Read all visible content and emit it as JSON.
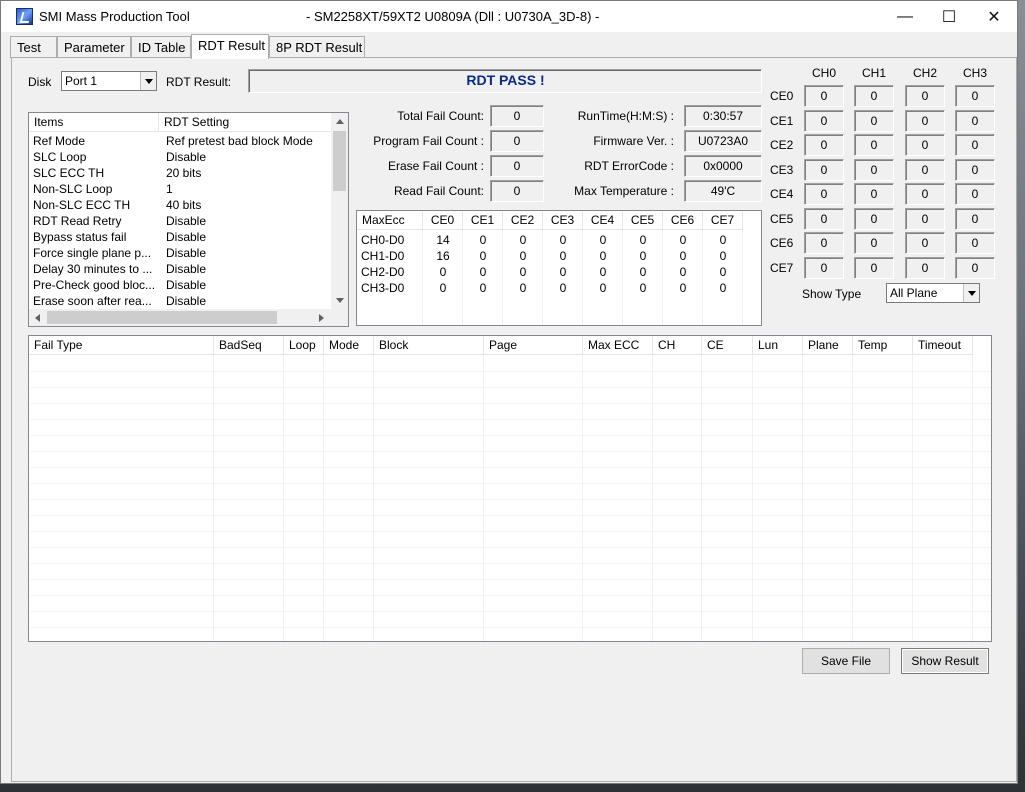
{
  "window": {
    "title": "SMI Mass Production Tool",
    "subtitle": "- SM2258XT/59XT2    U0809A      (Dll : U0730A_3D-8) -",
    "minimize_glyph": "—",
    "maximize_glyph": "☐",
    "close_glyph": "✕"
  },
  "tabs": [
    "Test",
    "Parameter",
    "ID Table",
    "RDT Result",
    "8P RDT Result"
  ],
  "active_tab": "RDT Result",
  "disk": {
    "label": "Disk",
    "value": "Port 1"
  },
  "rdt_result": {
    "label": "RDT Result:",
    "value": "RDT PASS !",
    "color": "#0a2a8a"
  },
  "settings": {
    "headers": [
      "Items",
      "RDT Setting"
    ],
    "rows": [
      [
        "Ref Mode",
        "Ref pretest bad block Mode"
      ],
      [
        "SLC Loop",
        "Disable"
      ],
      [
        "SLC ECC TH",
        "20 bits"
      ],
      [
        "Non-SLC Loop",
        "1"
      ],
      [
        "Non-SLC ECC TH",
        "40 bits"
      ],
      [
        "RDT Read Retry",
        "Disable"
      ],
      [
        "Bypass status fail",
        "Disable"
      ],
      [
        "Force single plane p...",
        "Disable"
      ],
      [
        "Delay 30 minutes to ...",
        "Disable"
      ],
      [
        "Pre-Check good bloc...",
        "Disable"
      ],
      [
        "Erase soon after rea...",
        "Disable"
      ]
    ]
  },
  "stats_left": [
    {
      "label": "Total Fail Count:",
      "value": "0"
    },
    {
      "label": "Program Fail Count :",
      "value": "0"
    },
    {
      "label": "Erase Fail Count :",
      "value": "0"
    },
    {
      "label": "Read Fail Count:",
      "value": "0"
    }
  ],
  "stats_right": [
    {
      "label": "RunTime(H:M:S) :",
      "value": "0:30:57"
    },
    {
      "label": "Firmware Ver. :",
      "value": "U0723A0"
    },
    {
      "label": "RDT ErrorCode :",
      "value": "0x0000"
    },
    {
      "label": "Max Temperature :",
      "value": "49'C"
    }
  ],
  "maxecc": {
    "headers": [
      "MaxEcc",
      "CE0",
      "CE1",
      "CE2",
      "CE3",
      "CE4",
      "CE5",
      "CE6",
      "CE7"
    ],
    "rows": [
      [
        "CH0-D0",
        "14",
        "0",
        "0",
        "0",
        "0",
        "0",
        "0",
        "0"
      ],
      [
        "CH1-D0",
        "16",
        "0",
        "0",
        "0",
        "0",
        "0",
        "0",
        "0"
      ],
      [
        "CH2-D0",
        "0",
        "0",
        "0",
        "0",
        "0",
        "0",
        "0",
        "0"
      ],
      [
        "CH3-D0",
        "0",
        "0",
        "0",
        "0",
        "0",
        "0",
        "0",
        "0"
      ]
    ]
  },
  "grid": {
    "channels": [
      "CH0",
      "CH1",
      "CH2",
      "CH3"
    ],
    "ces": [
      "CE0",
      "CE1",
      "CE2",
      "CE3",
      "CE4",
      "CE5",
      "CE6",
      "CE7"
    ],
    "values": [
      [
        "0",
        "0",
        "0",
        "0"
      ],
      [
        "0",
        "0",
        "0",
        "0"
      ],
      [
        "0",
        "0",
        "0",
        "0"
      ],
      [
        "0",
        "0",
        "0",
        "0"
      ],
      [
        "0",
        "0",
        "0",
        "0"
      ],
      [
        "0",
        "0",
        "0",
        "0"
      ],
      [
        "0",
        "0",
        "0",
        "0"
      ],
      [
        "0",
        "0",
        "0",
        "0"
      ]
    ]
  },
  "show_type": {
    "label": "Show Type",
    "value": "All Plane"
  },
  "fail_table": {
    "headers": [
      "Fail Type",
      "BadSeq",
      "Loop",
      "Mode",
      "Block",
      "Page",
      "Max ECC",
      "CH",
      "CE",
      "Lun",
      "Plane",
      "Temp",
      "Timeout"
    ]
  },
  "buttons": {
    "save_file": "Save File",
    "show_result": "Show Result"
  }
}
